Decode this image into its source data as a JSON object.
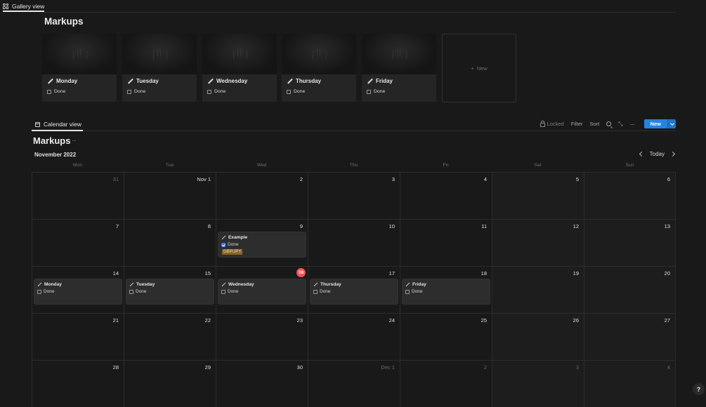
{
  "gallery": {
    "tab_label": "Gallery view",
    "title": "Markups",
    "cards": [
      {
        "title": "Monday",
        "done_label": "Done"
      },
      {
        "title": "Tuesday",
        "done_label": "Done"
      },
      {
        "title": "Wednesday",
        "done_label": "Done"
      },
      {
        "title": "Thursday",
        "done_label": "Done"
      },
      {
        "title": "Friday",
        "done_label": "Done"
      }
    ],
    "new_label": "New",
    "new_icon": "plus-icon"
  },
  "calendar": {
    "tab_label": "Calendar view",
    "title": "Markups",
    "toolbar": {
      "locked_label": "Locked",
      "filter_label": "Filter",
      "sort_label": "Sort",
      "new_label": "New"
    },
    "month_label": "November 2022",
    "today_label": "Today",
    "weekdays": [
      "Mon",
      "Tue",
      "Wed",
      "Thu",
      "Fri",
      "Sat",
      "Sun"
    ],
    "weeks": [
      [
        "31",
        "Nov 1",
        "2",
        "3",
        "4",
        "5",
        "6"
      ],
      [
        "7",
        "8",
        "9",
        "10",
        "11",
        "12",
        "13"
      ],
      [
        "14",
        "15",
        "16",
        "17",
        "18",
        "19",
        "20"
      ],
      [
        "21",
        "22",
        "23",
        "24",
        "25",
        "26",
        "27"
      ],
      [
        "28",
        "29",
        "30",
        "Dec 1",
        "2",
        "3",
        "4"
      ]
    ],
    "events": {
      "example": {
        "title": "Example",
        "done_label": "Done",
        "tag": "GBP/JPY"
      },
      "monday": {
        "title": "Monday",
        "done_label": "Done"
      },
      "tuesday": {
        "title": "Tuesday",
        "done_label": "Done"
      },
      "wednesday": {
        "title": "Wednesday",
        "done_label": "Done"
      },
      "thursday": {
        "title": "Thursday",
        "done_label": "Done"
      },
      "friday": {
        "title": "Friday",
        "done_label": "Done"
      }
    }
  },
  "help_label": "?",
  "colors": {
    "background": "#191919",
    "accent": "#2383e2",
    "today": "#eb5757",
    "tag": "#89632a"
  }
}
